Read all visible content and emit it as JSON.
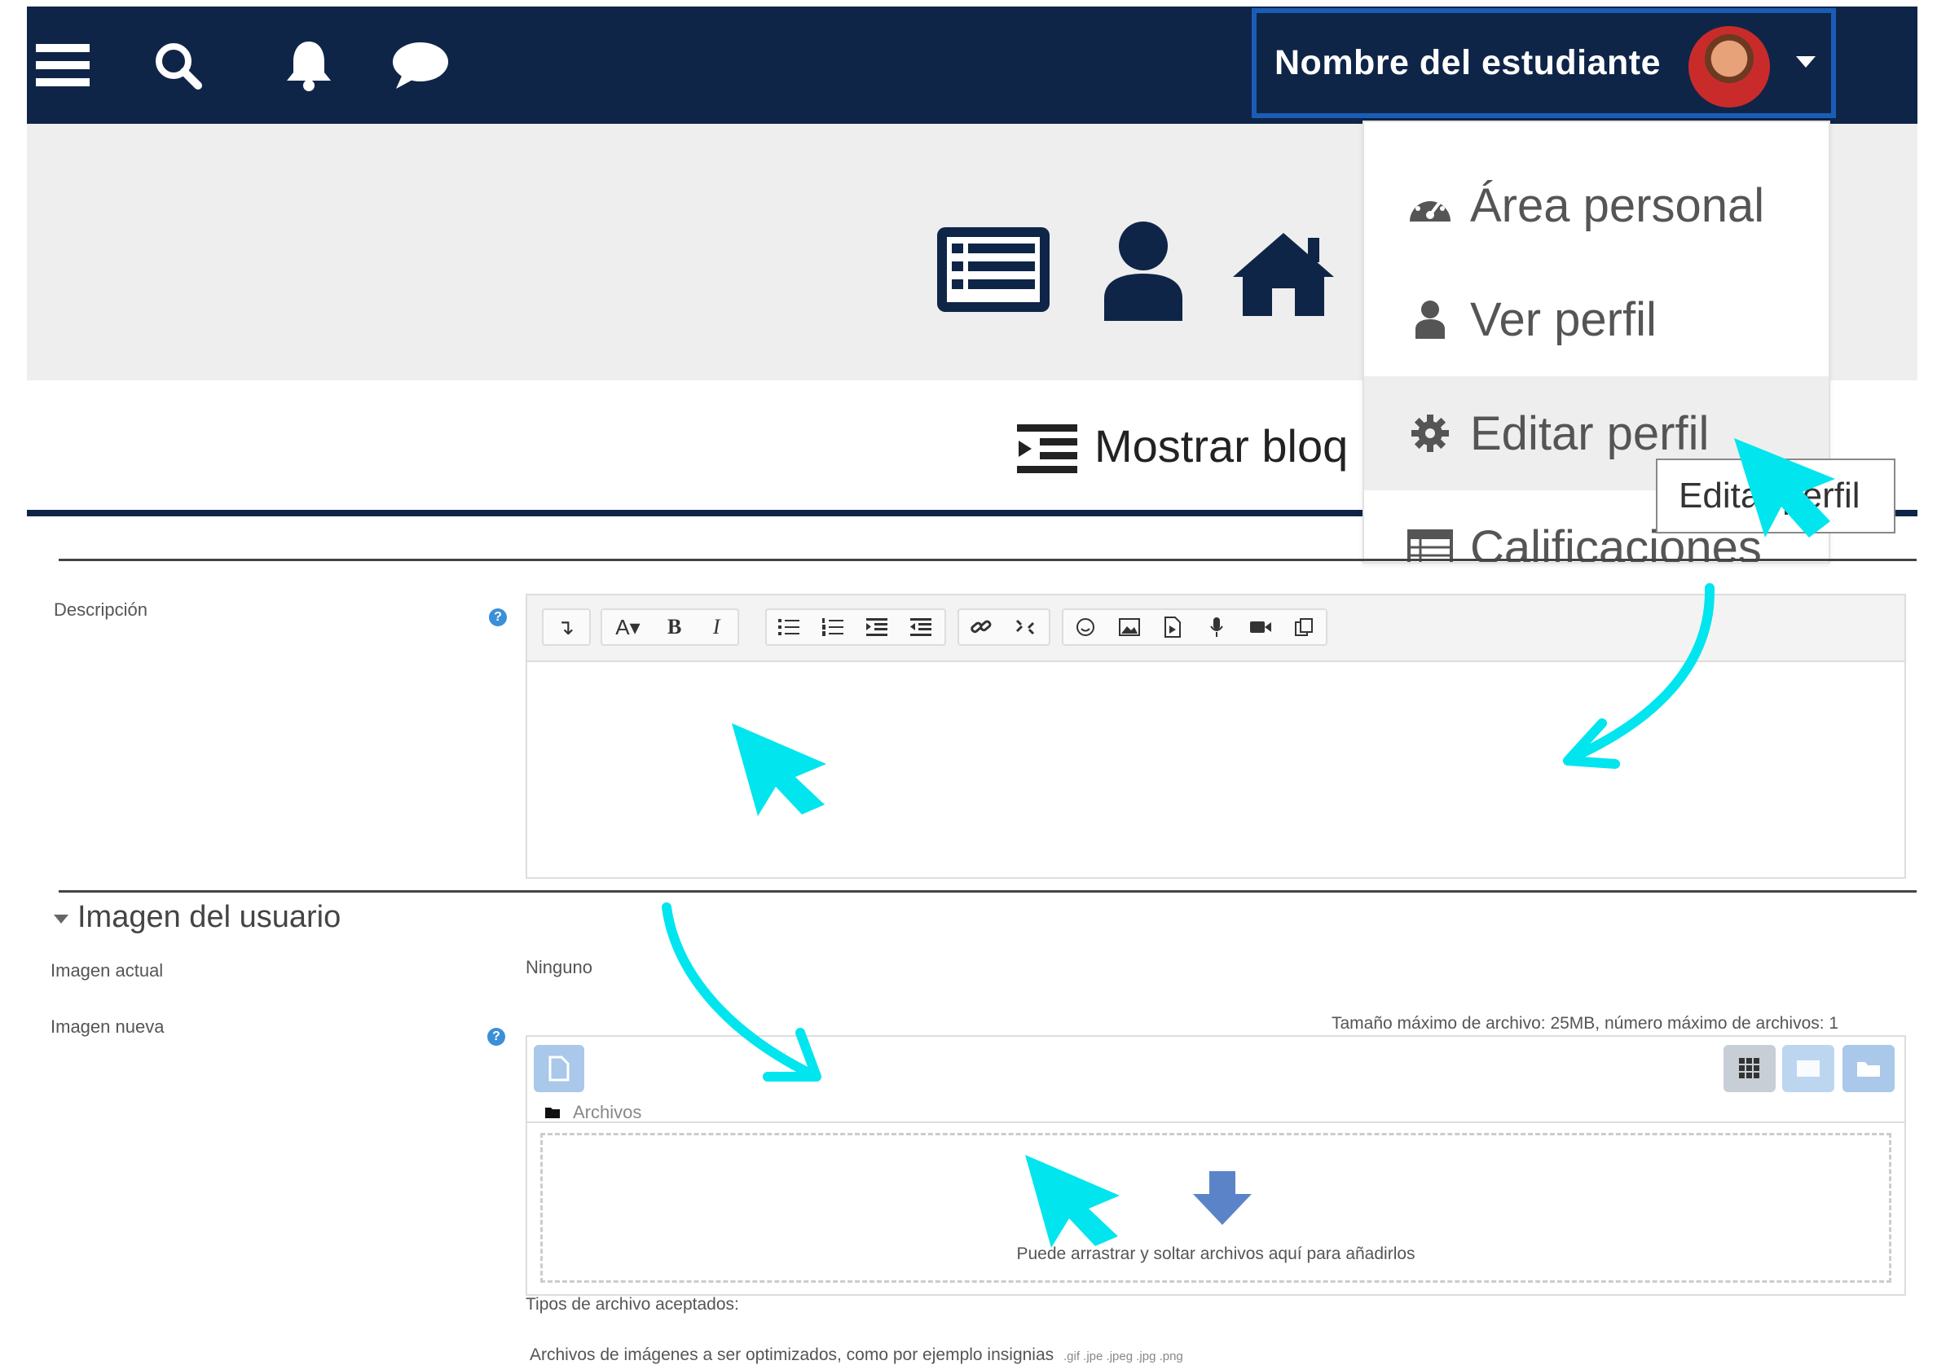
{
  "navbar": {
    "icons": [
      "menu-icon",
      "search-icon",
      "bell-icon",
      "chat-icon"
    ],
    "user_name": "Nombre del estudiante"
  },
  "header": {
    "icons": [
      "list-icon",
      "user-icon",
      "home-icon"
    ]
  },
  "blocks": {
    "label": "Mostrar bloq"
  },
  "user_menu": {
    "items": [
      {
        "label": "Área personal",
        "icon": "dashboard-icon"
      },
      {
        "label": "Ver perfil",
        "icon": "user-icon"
      },
      {
        "label": "Editar perfil",
        "icon": "gear-icon"
      },
      {
        "label": "Calificaciones",
        "icon": "table-icon"
      }
    ],
    "tooltip": "Editar perfil"
  },
  "form": {
    "description_label": "Descripción",
    "section_title": "Imagen del usuario",
    "current_image_label": "Imagen actual",
    "current_image_value": "Ninguno",
    "new_image_label": "Imagen nueva",
    "file_limits": "Tamaño máximo de archivo: 25MB, número máximo de archivos: 1",
    "files_path": "Archivos",
    "drop_hint": "Puede arrastrar y soltar archivos aquí para añadirlos",
    "accepted_types_label": "Tipos de archivo aceptados:",
    "accepted_types_desc": "Archivos de imágenes a ser optimizados, como por ejemplo insignias",
    "accepted_types_ext": ".gif .jpe .jpeg .jpg .png"
  },
  "toolbar": {
    "buttons": [
      "↴",
      "A▾",
      "B",
      "I"
    ]
  },
  "colors": {
    "navbar": "#0f2548",
    "accent_border": "#1b5db5",
    "annotation_arrow": "#00e5ee",
    "help": "#3b8fd8"
  }
}
